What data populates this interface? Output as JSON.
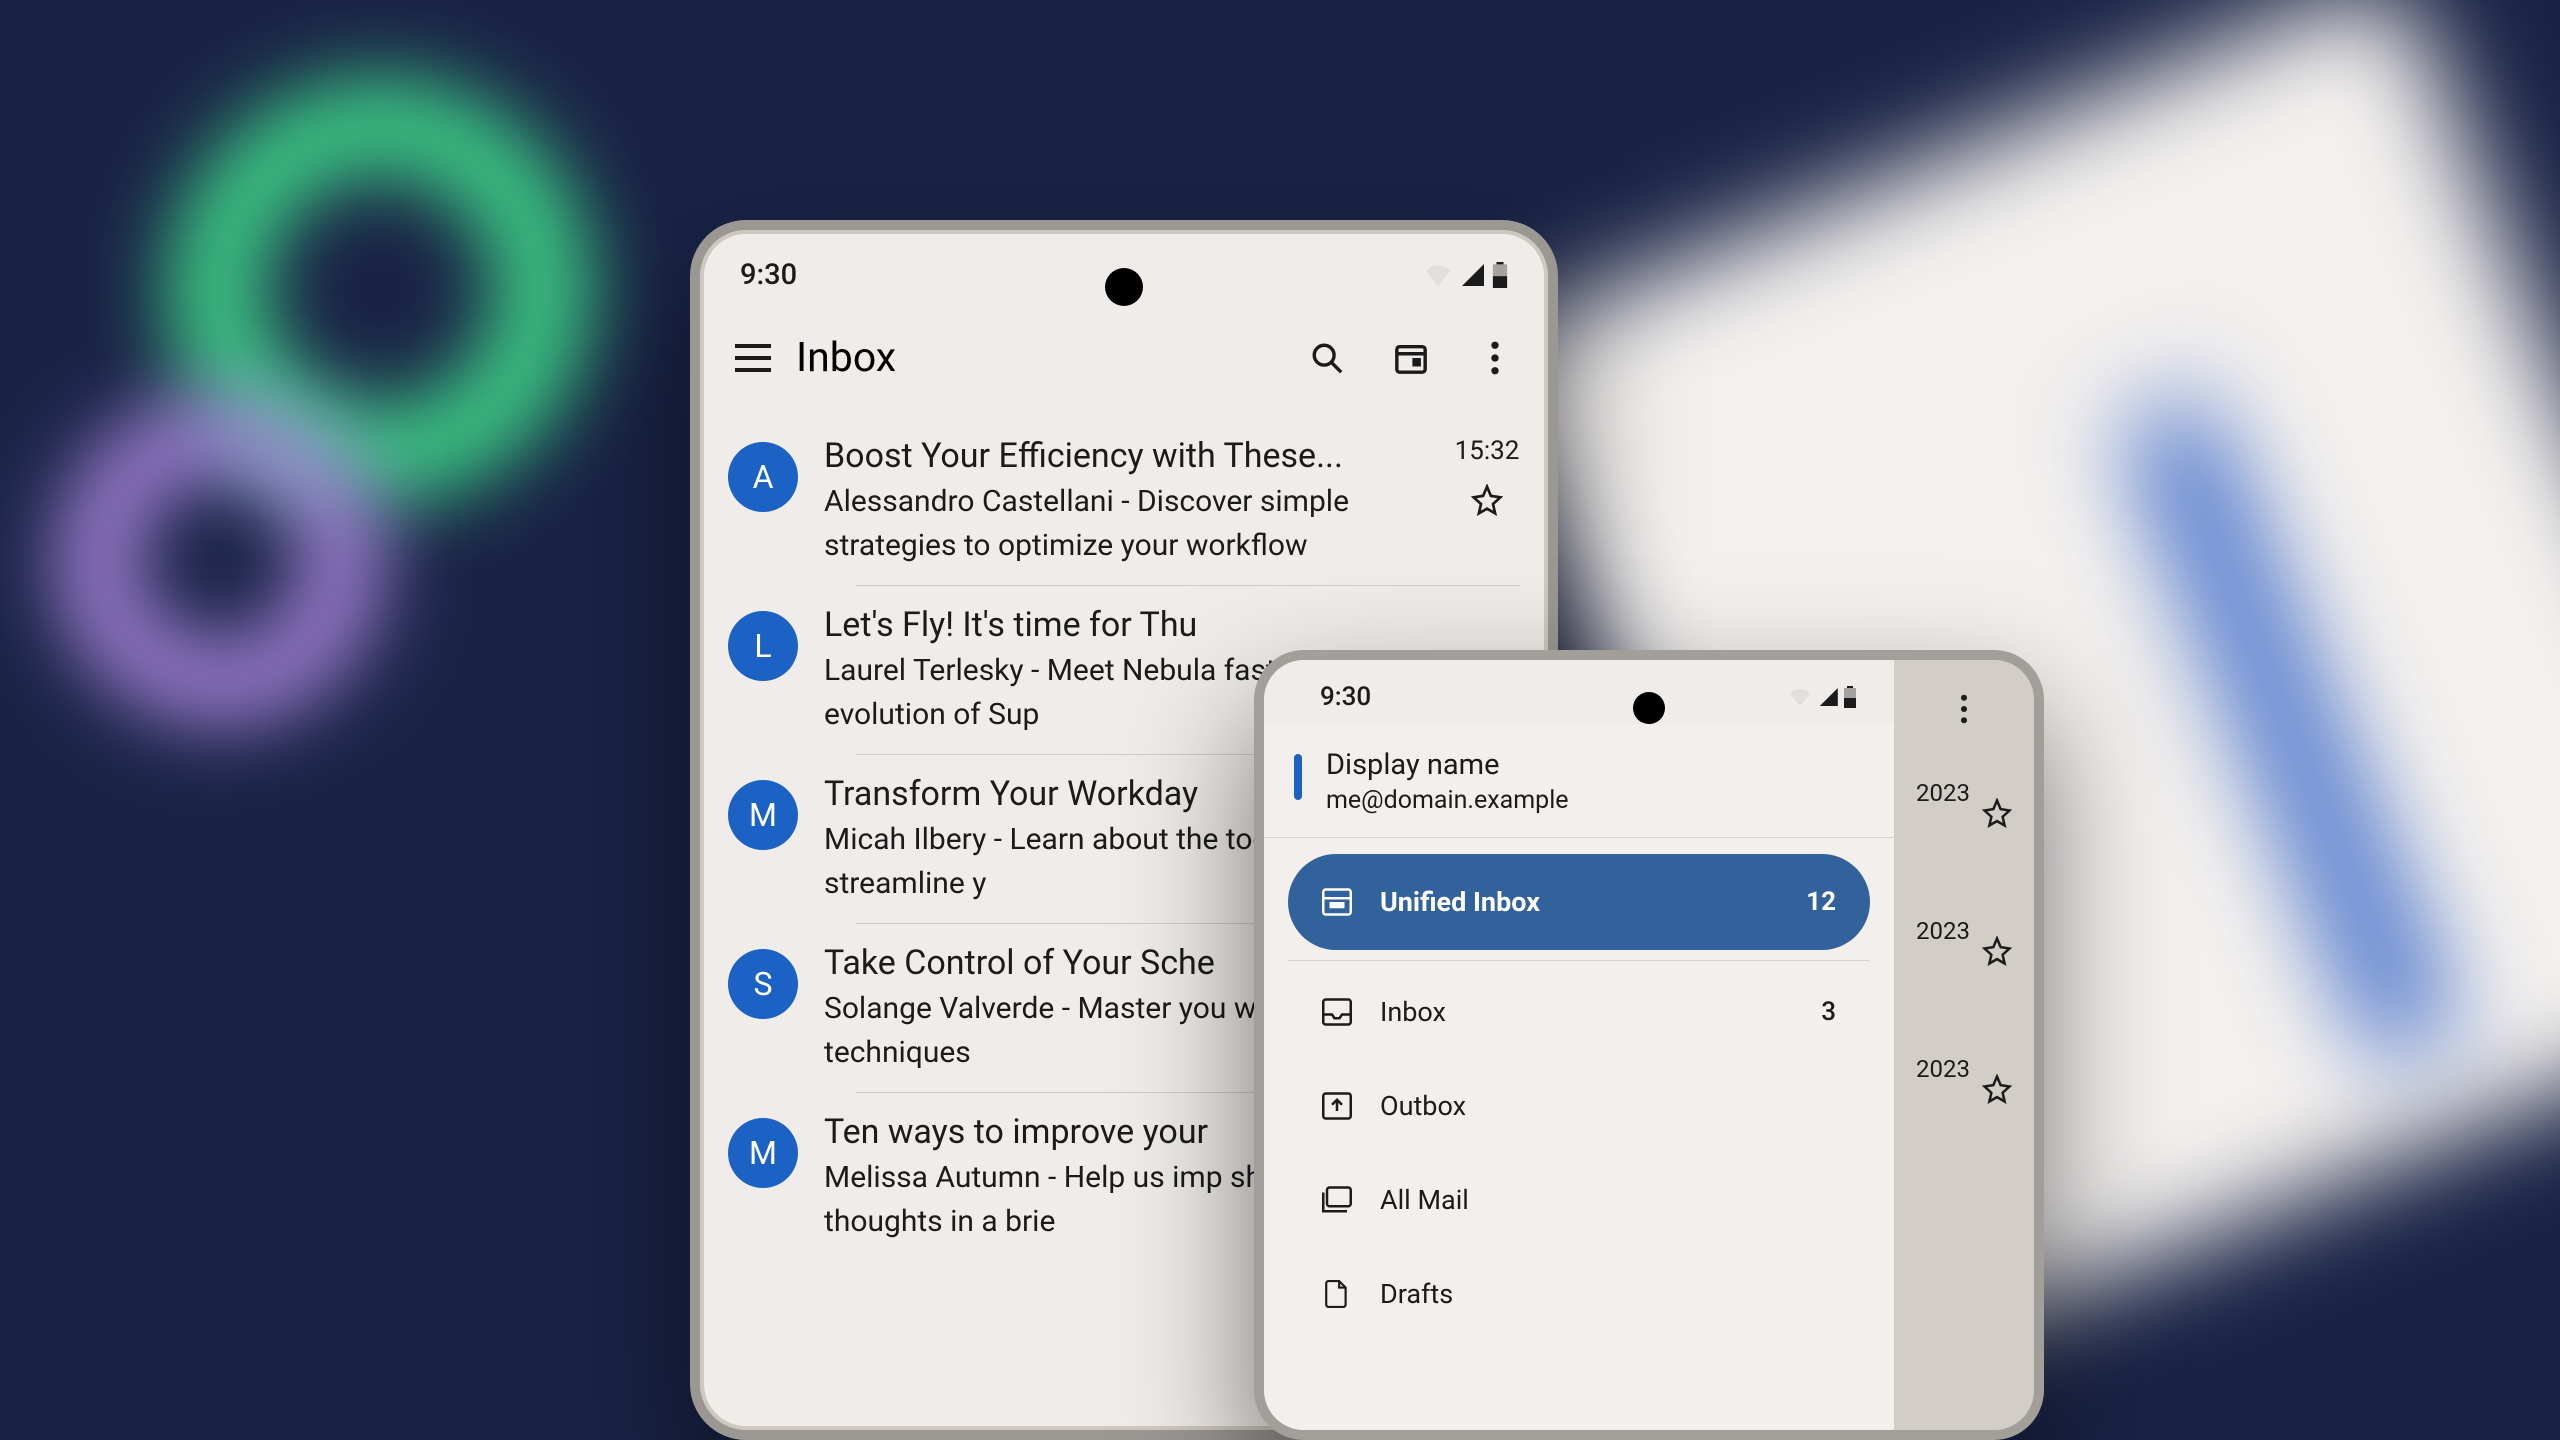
{
  "phone1": {
    "status_time": "9:30",
    "app_title": "Inbox",
    "mails": [
      {
        "avatar": "A",
        "subject": "Boost Your Efficiency with These...",
        "preview": "Alessandro Castellani - Discover simple strategies to optimize your workflow",
        "time": "15:32"
      },
      {
        "avatar": "L",
        "subject": "Let's Fly! It's time for Thu",
        "preview": "Laurel Terlesky - Meet Nebula fast and fluid evolution of Sup",
        "time": ""
      },
      {
        "avatar": "M",
        "subject": "Transform Your Workday",
        "preview": "Micah Ilbery - Learn about the tools designed to streamline y",
        "time": ""
      },
      {
        "avatar": "S",
        "subject": "Take Control of Your Sche",
        "preview": "Solange Valverde - Master you with these proven techniques",
        "time": ""
      },
      {
        "avatar": "M",
        "subject": "Ten ways to improve your",
        "preview": "Melissa Autumn - Help us imp sharing your thoughts in a brie",
        "time": ""
      }
    ]
  },
  "phone2": {
    "status_time": "9:30",
    "account": {
      "display_name": "Display name",
      "email": "me@domain.example"
    },
    "nav": [
      {
        "icon": "unified",
        "label": "Unified Inbox",
        "count": "12",
        "active": true
      },
      {
        "icon": "inbox",
        "label": "Inbox",
        "count": "3",
        "active": false
      },
      {
        "icon": "outbox",
        "label": "Outbox",
        "count": "",
        "active": false
      },
      {
        "icon": "allmail",
        "label": "All Mail",
        "count": "",
        "active": false
      },
      {
        "icon": "drafts",
        "label": "Drafts",
        "count": "",
        "active": false
      }
    ],
    "behind_rows": [
      {
        "text": "2023"
      },
      {
        "text": "2023"
      },
      {
        "text": "2023"
      }
    ]
  }
}
